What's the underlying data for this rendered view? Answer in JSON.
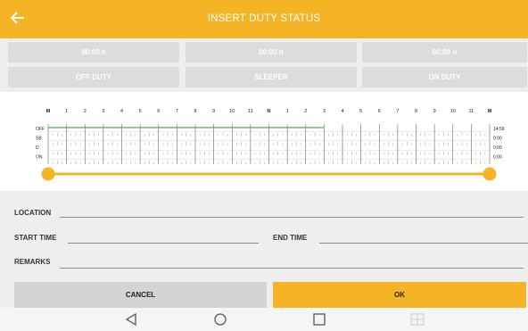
{
  "header": {
    "title": "INSERT DUTY STATUS",
    "back_icon": "arrow-left-icon"
  },
  "duty_totals": [
    {
      "time": "00:00 h",
      "label": "OFF DUTY"
    },
    {
      "time": "00:00 h",
      "label": "SLEEPER"
    },
    {
      "time": "00:00 h",
      "label": "ON DUTY"
    }
  ],
  "chart_data": {
    "type": "line",
    "x_labels": [
      "M",
      "1",
      "2",
      "3",
      "4",
      "5",
      "6",
      "7",
      "8",
      "9",
      "10",
      "11",
      "N",
      "1",
      "2",
      "3",
      "4",
      "5",
      "6",
      "7",
      "8",
      "9",
      "10",
      "11",
      "M"
    ],
    "rows": [
      "OFF",
      "SB",
      "D",
      "ON"
    ],
    "row_totals": [
      "14:59",
      "0:00",
      "0:00",
      "0:00"
    ],
    "series": [
      {
        "row": "OFF",
        "start_hour": 0,
        "end_hour": 15
      }
    ],
    "range_slider": {
      "start_hour": 0,
      "end_hour": 24
    },
    "colors": {
      "line": "#4caf50",
      "slider": "#f5b326"
    }
  },
  "form": {
    "location_label": "LOCATION",
    "location_value": "",
    "start_time_label": "START TIME",
    "start_time_value": "",
    "end_time_label": "END TIME",
    "end_time_value": "",
    "remarks_label": "REMARKS",
    "remarks_value": ""
  },
  "buttons": {
    "cancel": "CANCEL",
    "ok": "OK"
  },
  "colors": {
    "accent": "#f5b326",
    "cancel_bg": "#d4d4d4"
  },
  "navbar": {
    "icons": [
      "back-triangle-icon",
      "home-circle-icon",
      "recents-square-icon",
      "grid-icon"
    ]
  }
}
